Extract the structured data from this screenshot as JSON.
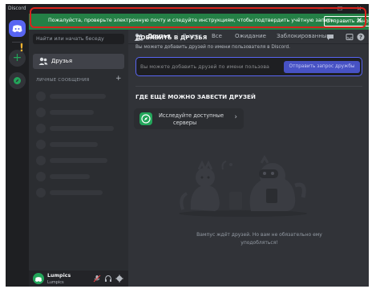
{
  "window": {
    "title": "Discord",
    "minimize_glyph": "—",
    "maximize_glyph": "☐",
    "close_glyph": "✕"
  },
  "banner": {
    "message": "Пожалуйста, проверьте электронную почту и следуйте инструкциям, чтобы подтвердить учётную запись.",
    "resend_label": "Отправить заново",
    "close_glyph": "✕",
    "color": "#248046"
  },
  "rail": {
    "home_icon": "discord-logo-icon",
    "add_label": "+",
    "alert_glyph": "!",
    "explore_icon": "compass-icon"
  },
  "sidebar": {
    "search_placeholder": "Найти или начать беседу",
    "friends_label": "Друзья",
    "dm_header": "ЛИЧНЫЕ СООБЩЕНИЯ",
    "dm_add": "+"
  },
  "user": {
    "name": "Lumpics",
    "tag": "Lumpics"
  },
  "topbar": {
    "friends_title": "Друзья",
    "tabs": [
      "В сети",
      "Все",
      "Ожидание",
      "Заблокированные"
    ],
    "add_friend_tab": "Добавить в друзья"
  },
  "add_friend": {
    "title": "ДОБАВИТЬ В ДРУЗЬЯ",
    "description": "Вы можете добавить друзей по имени пользователя в Discord.",
    "placeholder": "Вы можете добавить друзей по имени пользова",
    "button": "Отправить запрос дружбы"
  },
  "where": {
    "title": "ГДЕ ЕЩЁ МОЖНО ЗАВЕСТИ ДРУЗЕЙ",
    "explore_label_line1": "Исследуйте доступные",
    "explore_label_line2": "серверы",
    "chevron": "›"
  },
  "empty_state": {
    "text": "Вампус ждёт друзей. Но вам не обязательно ему уподобляться!"
  },
  "colors": {
    "accent": "#5865f2",
    "green": "#23a55a",
    "highlight": "#d8231c"
  }
}
